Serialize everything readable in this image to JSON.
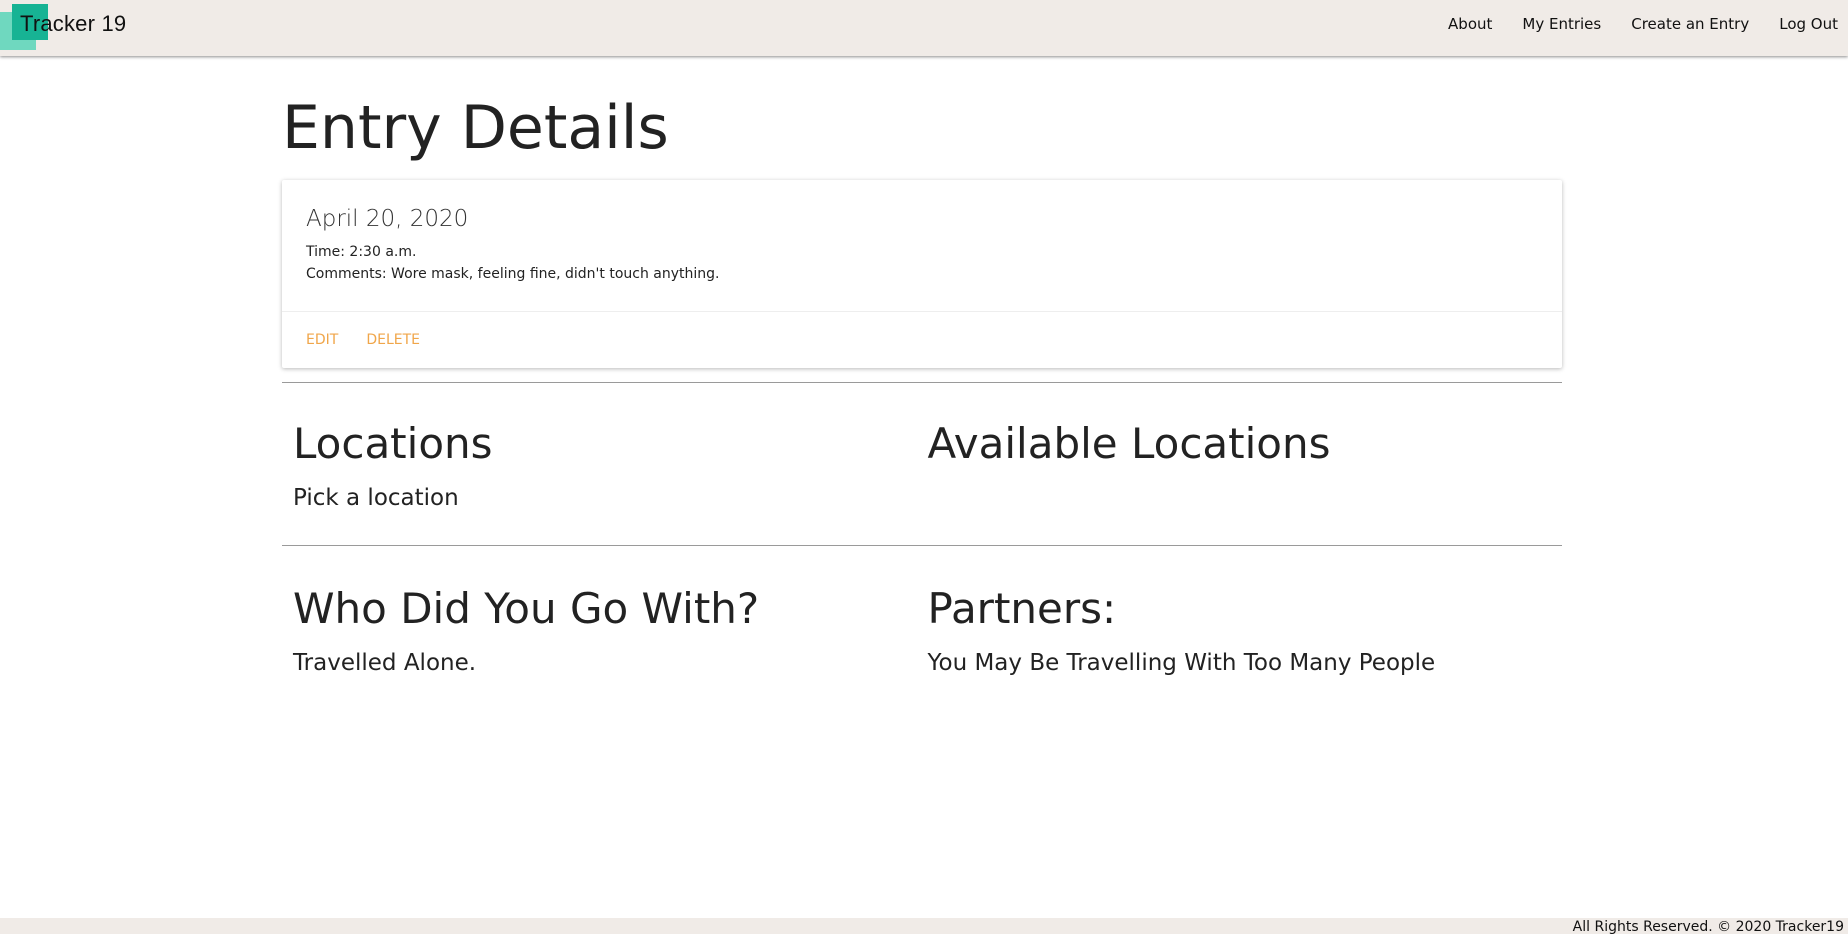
{
  "navbar": {
    "brand": "Tracker 19",
    "links": [
      "About",
      "My Entries",
      "Create an Entry",
      "Log Out"
    ]
  },
  "page": {
    "title": "Entry Details"
  },
  "entry": {
    "date": "April 20, 2020",
    "time": "Time: 2:30 a.m.",
    "comments": "Comments: Wore mask, feeling fine, didn't touch anything.",
    "actions": {
      "edit": "EDIT",
      "delete": "DELETE"
    }
  },
  "locations": {
    "heading": "Locations",
    "text": "Pick a location",
    "available_heading": "Available Locations"
  },
  "partners": {
    "heading": "Who Did You Go With?",
    "text": "Travelled Alone.",
    "partners_heading": "Partners:",
    "partners_text": "You May Be Travelling With Too Many People"
  },
  "footer": {
    "text": "All Rights Reserved. © 2020 Tracker19"
  },
  "colors": {
    "navbar_bg": "#f0ebe7",
    "logo_primary": "#17b394",
    "logo_secondary": "#6fd8bf",
    "action_link": "#f0a64a"
  }
}
